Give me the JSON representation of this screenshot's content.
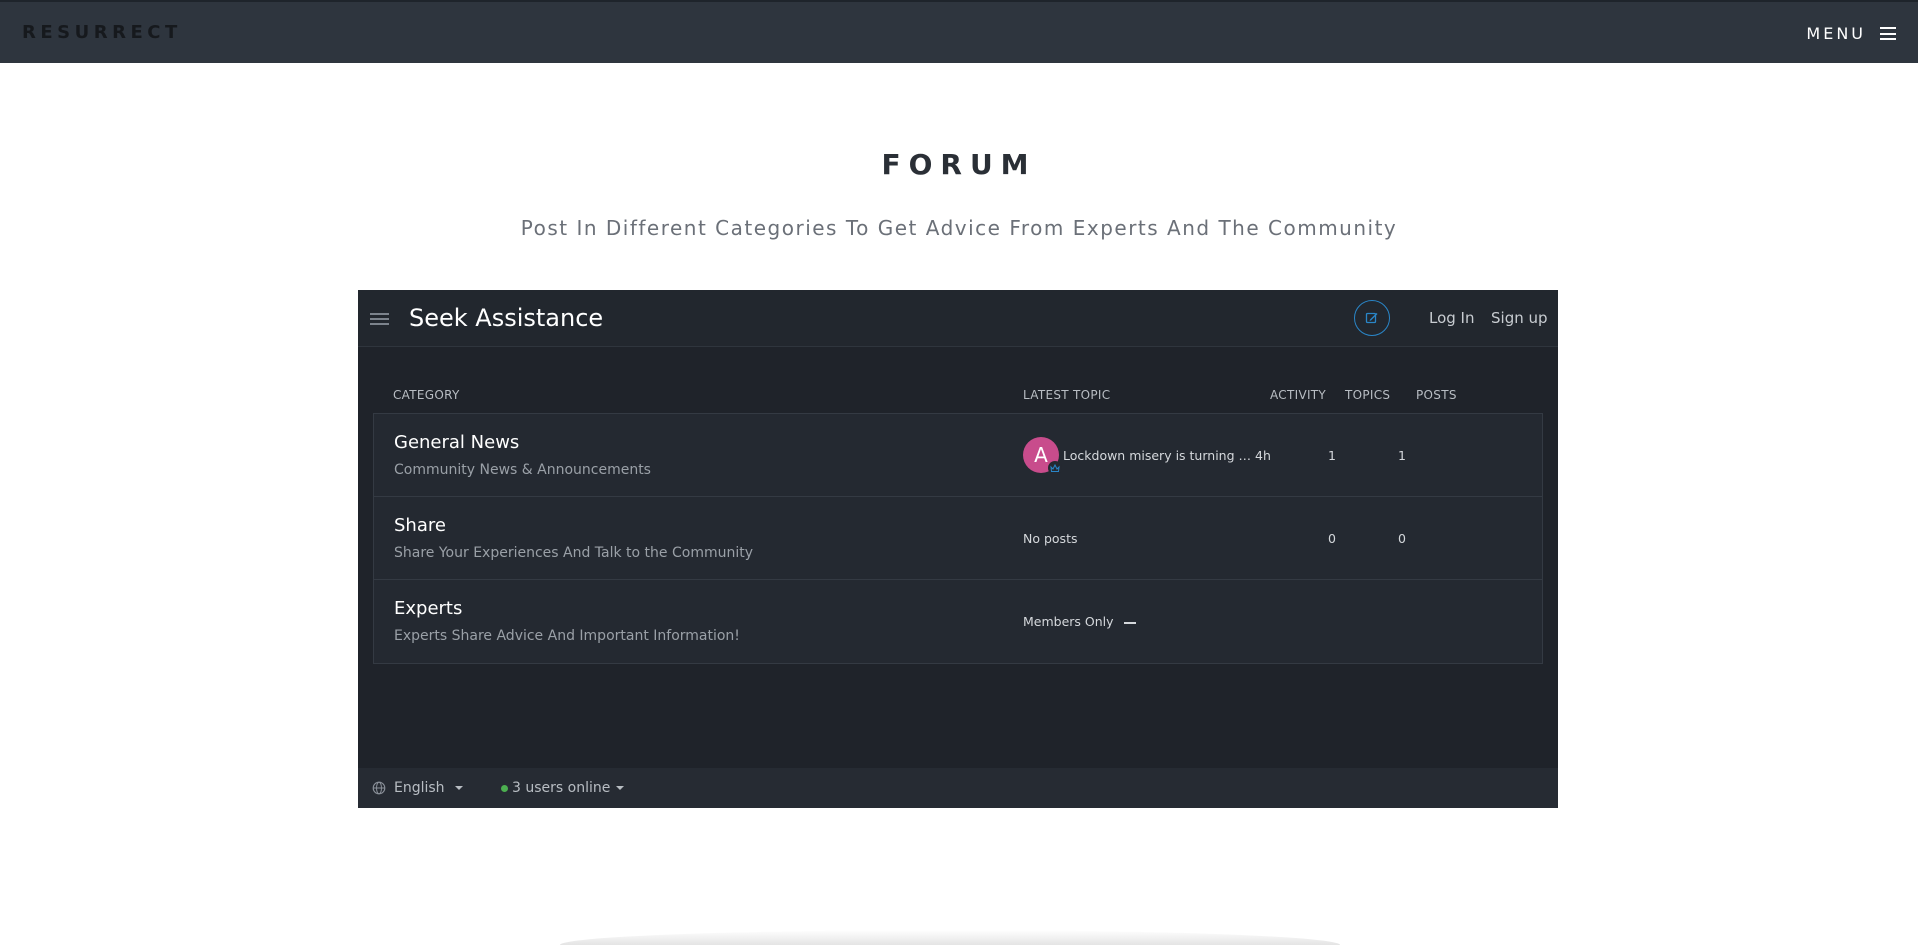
{
  "nav": {
    "logo": "RESURRECT",
    "menu_label": "MENU"
  },
  "hero": {
    "title": "FORUM",
    "subtitle": "Post In Different Categories To Get Advice From Experts And The Community"
  },
  "forum": {
    "title": "Seek Assistance",
    "login_label": "Log In",
    "signup_label": "Sign up",
    "columns": {
      "category": "CATEGORY",
      "latest_topic": "LATEST TOPIC",
      "activity": "ACTIVITY",
      "topics": "TOPICS",
      "posts": "POSTS"
    },
    "categories": [
      {
        "name": "General News",
        "description": "Community News & Announcements",
        "avatar_letter": "A",
        "latest": "Lockdown misery is turning a …",
        "activity": "4h",
        "topics": "1",
        "posts": "1"
      },
      {
        "name": "Share",
        "description": "Share Your Experiences And Talk to the Community",
        "latest": "No posts",
        "topics": "0",
        "posts": "0"
      },
      {
        "name": "Experts",
        "description": "Experts Share Advice And Important Information!",
        "latest": "Members Only"
      }
    ],
    "footer": {
      "language": "English",
      "users_online": "3 users online"
    },
    "colors": {
      "accent": "#2a86c8",
      "avatar": "#c84c8c",
      "online": "#4caf50"
    }
  }
}
